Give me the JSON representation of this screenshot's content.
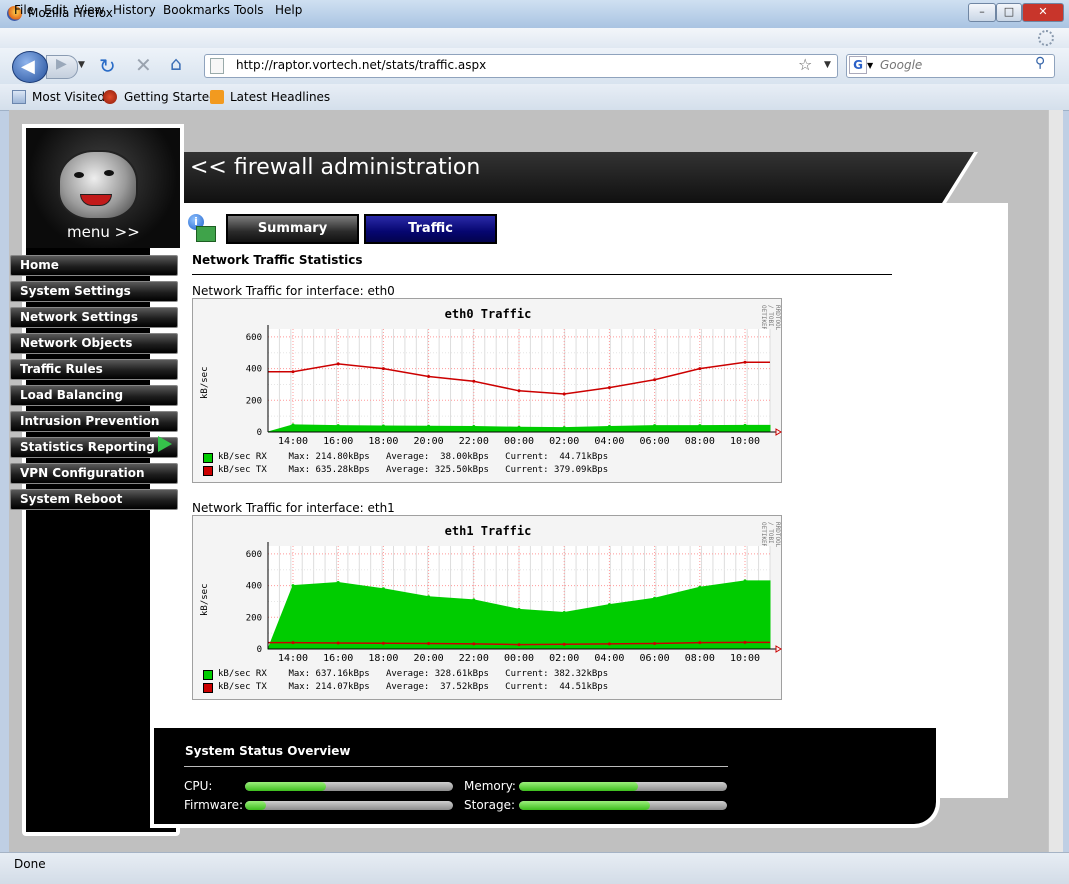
{
  "window": {
    "title": "Mozilla Firefox",
    "minimize": "–",
    "maximize": "□",
    "close": "✕",
    "close_color": "#c8352b"
  },
  "menubar": [
    "File",
    "Edit",
    "View",
    "History",
    "Bookmarks",
    "Tools",
    "Help"
  ],
  "navbar": {
    "url": "http://raptor.vortech.net/stats/traffic.aspx",
    "search_placeholder": "Google",
    "search_engine_icon": "G"
  },
  "bookmarks": [
    "Most Visited",
    "Getting Started",
    "Latest Headlines"
  ],
  "statusbar": {
    "text": "Done"
  },
  "page": {
    "title": "<< firewall administration",
    "menu_label": "menu >>",
    "nav": [
      "Home",
      "System Settings",
      "Network Settings",
      "Network Objects",
      "Traffic Rules",
      "Load Balancing",
      "Intrusion Prevention",
      "Statistics Reporting",
      "VPN Configuration",
      "System Reboot"
    ],
    "nav_active_index": 7,
    "tabs": [
      {
        "label": "Summary",
        "active": false
      },
      {
        "label": "Traffic",
        "active": true
      }
    ],
    "section_title": "Network Traffic Statistics",
    "graphs": [
      {
        "interface_label": "Network Traffic for interface: eth0",
        "title": "eth0 Traffic",
        "ylabel": "kB/sec",
        "side_text": "RRDTOOL / TOBI OETIKER",
        "yticks": [
          "600",
          "400",
          "200",
          "0"
        ],
        "xticks": [
          "14:00",
          "16:00",
          "18:00",
          "20:00",
          "22:00",
          "00:00",
          "02:00",
          "04:00",
          "06:00",
          "08:00",
          "10:00"
        ],
        "legend": [
          {
            "color": "#00cc00",
            "line": "kB/sec RX    Max: 214.80kBps   Average:  38.00kBps   Current:  44.71kBps"
          },
          {
            "color": "#cc0000",
            "line": "kB/sec TX    Max: 635.28kBps   Average: 325.50kBps   Current: 379.09kBps"
          }
        ]
      },
      {
        "interface_label": "Network Traffic for interface: eth1",
        "title": "eth1 Traffic",
        "ylabel": "kB/sec",
        "side_text": "RRDTOOL / TOBI OETIKER",
        "yticks": [
          "600",
          "400",
          "200",
          "0"
        ],
        "xticks": [
          "14:00",
          "16:00",
          "18:00",
          "20:00",
          "22:00",
          "00:00",
          "02:00",
          "04:00",
          "06:00",
          "08:00",
          "10:00"
        ],
        "legend": [
          {
            "color": "#00cc00",
            "line": "kB/sec RX    Max: 637.16kBps   Average: 328.61kBps   Current: 382.32kBps"
          },
          {
            "color": "#cc0000",
            "line": "kB/sec TX    Max: 214.07kBps   Average:  37.52kBps   Current:  44.51kBps"
          }
        ]
      }
    ],
    "status": {
      "title": "System Status Overview",
      "items": [
        {
          "label": "CPU:",
          "fraction": 0.39
        },
        {
          "label": "Memory:",
          "fraction": 0.57
        },
        {
          "label": "Firmware:",
          "fraction": 0.1
        },
        {
          "label": "Storage:",
          "fraction": 0.63
        }
      ]
    }
  },
  "chart_data": [
    {
      "type": "line",
      "title": "eth0 Traffic",
      "ylabel": "kB/sec",
      "ylim": [
        0,
        650
      ],
      "x": [
        "14:00",
        "16:00",
        "18:00",
        "20:00",
        "22:00",
        "00:00",
        "02:00",
        "04:00",
        "06:00",
        "08:00",
        "10:00"
      ],
      "series": [
        {
          "name": "kB/sec RX",
          "color": "#00cc00",
          "values": [
            45,
            40,
            38,
            36,
            35,
            30,
            28,
            35,
            40,
            40,
            42
          ]
        },
        {
          "name": "kB/sec TX",
          "color": "#cc0000",
          "values": [
            380,
            430,
            400,
            350,
            320,
            260,
            240,
            280,
            330,
            400,
            440
          ]
        }
      ]
    },
    {
      "type": "area",
      "title": "eth1 Traffic",
      "ylabel": "kB/sec",
      "ylim": [
        0,
        650
      ],
      "x": [
        "14:00",
        "16:00",
        "18:00",
        "20:00",
        "22:00",
        "00:00",
        "02:00",
        "04:00",
        "06:00",
        "08:00",
        "10:00"
      ],
      "series": [
        {
          "name": "kB/sec RX",
          "color": "#00cc00",
          "values": [
            400,
            420,
            380,
            330,
            310,
            250,
            230,
            280,
            320,
            390,
            430
          ]
        },
        {
          "name": "kB/sec TX",
          "color": "#cc0000",
          "values": [
            40,
            38,
            36,
            35,
            32,
            28,
            30,
            32,
            35,
            40,
            42
          ]
        }
      ]
    }
  ]
}
